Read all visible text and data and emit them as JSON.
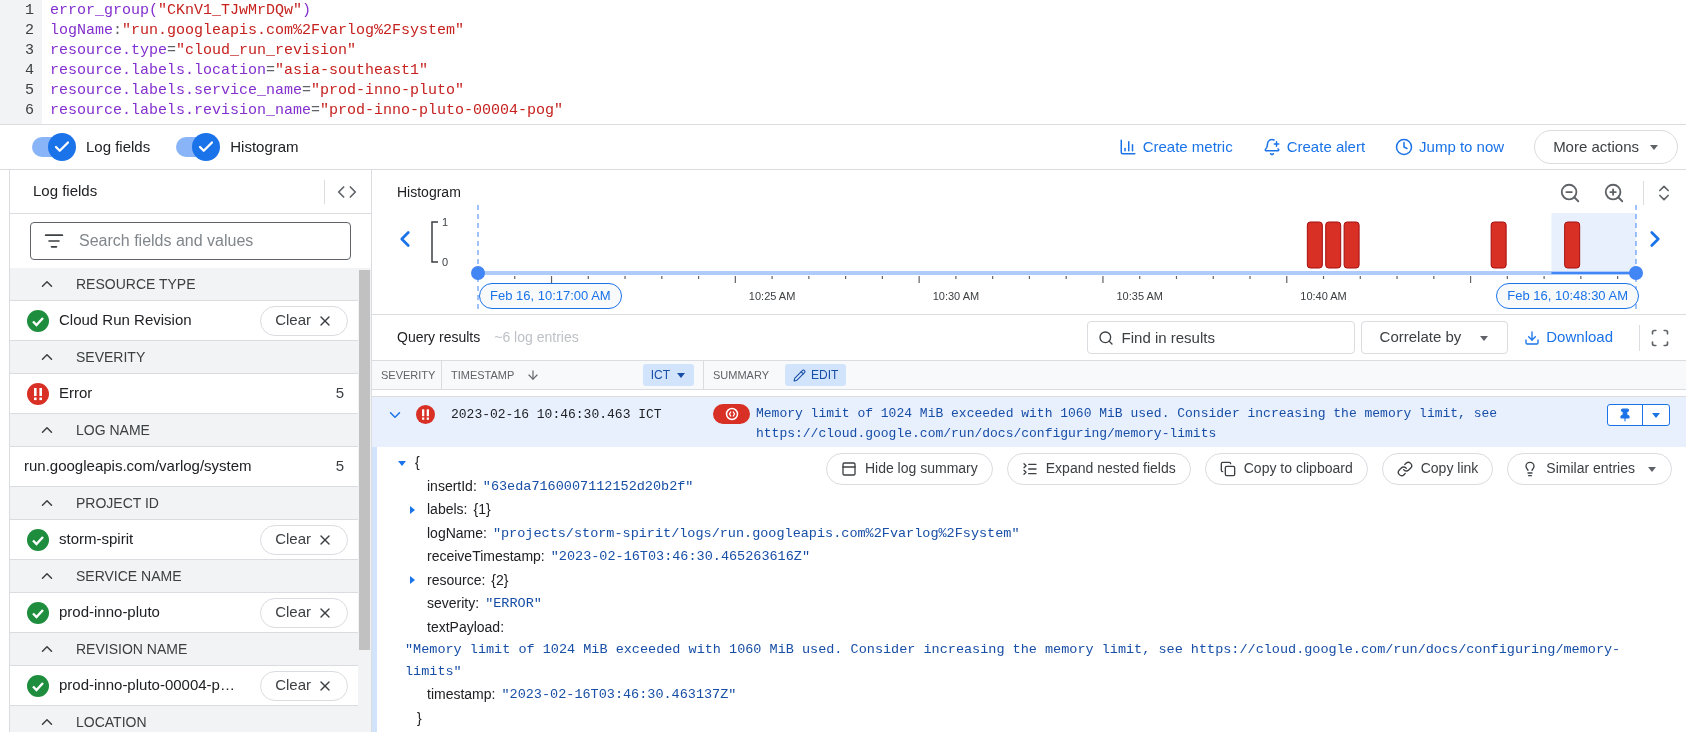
{
  "query": {
    "lines": [
      {
        "number": "1",
        "segments": [
          {
            "kind": "field",
            "text": "error_group("
          },
          {
            "kind": "string",
            "text": "\"CKnV1_TJwMrDQw\""
          },
          {
            "kind": "field",
            "text": ")"
          }
        ]
      },
      {
        "number": "2",
        "segments": [
          {
            "kind": "field",
            "text": "logName"
          },
          {
            "kind": "op",
            "text": ":"
          },
          {
            "kind": "string",
            "text": "\"run.googleapis.com%2Fvarlog%2Fsystem\""
          }
        ]
      },
      {
        "number": "3",
        "segments": [
          {
            "kind": "field",
            "text": "resource.type"
          },
          {
            "kind": "op",
            "text": "="
          },
          {
            "kind": "string",
            "text": "\"cloud_run_revision\""
          }
        ]
      },
      {
        "number": "4",
        "segments": [
          {
            "kind": "field",
            "text": "resource.labels.location"
          },
          {
            "kind": "op",
            "text": "="
          },
          {
            "kind": "string",
            "text": "\"asia-southeast1\""
          }
        ]
      },
      {
        "number": "5",
        "segments": [
          {
            "kind": "field",
            "text": "resource.labels.service_name"
          },
          {
            "kind": "op",
            "text": "="
          },
          {
            "kind": "string",
            "text": "\"prod-inno-pluto\""
          }
        ]
      },
      {
        "number": "6",
        "segments": [
          {
            "kind": "field",
            "text": "resource.labels.revision_name"
          },
          {
            "kind": "op",
            "text": "="
          },
          {
            "kind": "string",
            "text": "\"prod-inno-pluto-00004-pog\""
          }
        ]
      }
    ]
  },
  "toolbar": {
    "toggles": [
      {
        "label": "Log fields",
        "on": true
      },
      {
        "label": "Histogram",
        "on": true
      }
    ],
    "actions": [
      {
        "kind": "metric",
        "label": "Create metric"
      },
      {
        "kind": "alert",
        "label": "Create alert"
      },
      {
        "kind": "now",
        "label": "Jump to now"
      }
    ],
    "more": "More actions"
  },
  "log_fields": {
    "title": "Log fields",
    "search": {
      "placeholder": "Search fields and values"
    },
    "sections": [
      {
        "heading": "RESOURCE TYPE",
        "expanded": true,
        "items": [
          {
            "kind": "check",
            "label": "Cloud Run Revision",
            "clear": "Clear"
          }
        ]
      },
      {
        "heading": "SEVERITY",
        "expanded": true,
        "items": [
          {
            "kind": "error",
            "label": "Error",
            "count": "5"
          }
        ]
      },
      {
        "heading": "LOG NAME",
        "expanded": true,
        "items": [
          {
            "kind": "plain",
            "label": "run.googleapis.com/varlog/system",
            "count": "5"
          }
        ]
      },
      {
        "heading": "PROJECT ID",
        "expanded": true,
        "items": [
          {
            "kind": "check",
            "label": "storm-spirit",
            "clear": "Clear"
          }
        ]
      },
      {
        "heading": "SERVICE NAME",
        "expanded": true,
        "items": [
          {
            "kind": "check",
            "label": "prod-inno-pluto",
            "clear": "Clear"
          }
        ]
      },
      {
        "heading": "REVISION NAME",
        "expanded": true,
        "items": [
          {
            "kind": "check",
            "label": "prod-inno-pluto-00004-p…",
            "clear": "Clear"
          }
        ]
      },
      {
        "heading": "LOCATION",
        "expanded": true
      }
    ]
  },
  "histogram": {
    "title": "Histogram",
    "range_start": "Feb 16, 10:17:00 AM",
    "range_end": "Feb 16, 10:48:30 AM",
    "chart_data": {
      "type": "bar",
      "categories": [
        null,
        null,
        null,
        null,
        null,
        null,
        null,
        null,
        null,
        null,
        null,
        null,
        null,
        null,
        null,
        null,
        "10:25 AM",
        null,
        null,
        null,
        null,
        null,
        null,
        null,
        null,
        null,
        "10:30 AM",
        null,
        null,
        null,
        null,
        null,
        null,
        null,
        null,
        null,
        "10:35 AM",
        null,
        null,
        null,
        null,
        null,
        null,
        null,
        null,
        null,
        "10:40 AM",
        null,
        null,
        null,
        null,
        null,
        null,
        null,
        null,
        null,
        null,
        null,
        null,
        null,
        null,
        null,
        null
      ],
      "series": [
        {
          "color": "#d93025",
          "values": [
            0,
            0,
            0,
            0,
            0,
            0,
            0,
            0,
            0,
            0,
            0,
            0,
            0,
            0,
            0,
            0,
            0,
            0,
            0,
            0,
            0,
            0,
            0,
            0,
            0,
            0,
            0,
            0,
            0,
            0,
            0,
            0,
            0,
            0,
            0,
            0,
            0,
            0,
            0,
            0,
            0,
            0,
            0,
            0,
            0,
            1,
            1,
            1,
            0,
            0,
            0,
            0,
            0,
            0,
            0,
            1,
            0,
            0,
            0,
            1,
            0,
            0,
            0
          ]
        }
      ],
      "ylim": [
        0,
        1
      ],
      "yticks": [
        0,
        1
      ]
    }
  },
  "results": {
    "title": "Query results",
    "count": "~6 log entries",
    "find": {
      "placeholder": "Find in results"
    },
    "correlate": "Correlate by",
    "download": "Download"
  },
  "table": {
    "columns": [
      {
        "label": "SEVERITY"
      },
      {
        "label": "TIMESTAMP",
        "timezone": "ICT"
      },
      {
        "label": "SUMMARY",
        "edit": "EDIT"
      }
    ],
    "rows": [
      {
        "expanded": true,
        "kind": "error",
        "timestamp": "2023-02-16 10:46:30.463 ICT",
        "summary": "Memory limit of 1024 MiB exceeded with 1060 MiB used. Consider increasing the memory limit, see https://cloud.google.com/run/docs/configuring/memory-limits"
      }
    ]
  },
  "detail": {
    "buttons": [
      {
        "kind": "summary",
        "label": "Hide log summary"
      },
      {
        "kind": "expand",
        "label": "Expand nested fields"
      },
      {
        "kind": "copy",
        "label": "Copy to clipboard"
      },
      {
        "kind": "link",
        "label": "Copy link"
      },
      {
        "kind": "similar",
        "label": "Similar entries"
      }
    ],
    "json": {
      "open": "{",
      "close": "}",
      "expanded": true,
      "fields": [
        {
          "kind": "string",
          "key": "insertId:",
          "value": "\"63eda7160007112152d20b2f\""
        },
        {
          "kind": "object",
          "key": "labels:",
          "value": "{1}",
          "expanded": false
        },
        {
          "kind": "string",
          "key": "logName:",
          "value": "\"projects/storm-spirit/logs/run.googleapis.com%2Fvarlog%2Fsystem\""
        },
        {
          "kind": "string",
          "key": "receiveTimestamp:",
          "value": "\"2023-02-16T03:46:30.465263616Z\""
        },
        {
          "kind": "object",
          "key": "resource:",
          "value": "{2}",
          "expanded": false
        },
        {
          "kind": "string",
          "key": "severity:",
          "value": "\"ERROR\""
        },
        {
          "kind": "block",
          "key": "textPayload:",
          "value": "\"Memory limit of 1024 MiB exceeded with 1060 MiB used. Consider increasing the memory limit, see https://cloud.google.com/run/docs/configuring/memory-limits\""
        },
        {
          "kind": "string",
          "key": "timestamp:",
          "value": "\"2023-02-16T03:46:30.463137Z\""
        }
      ]
    }
  }
}
